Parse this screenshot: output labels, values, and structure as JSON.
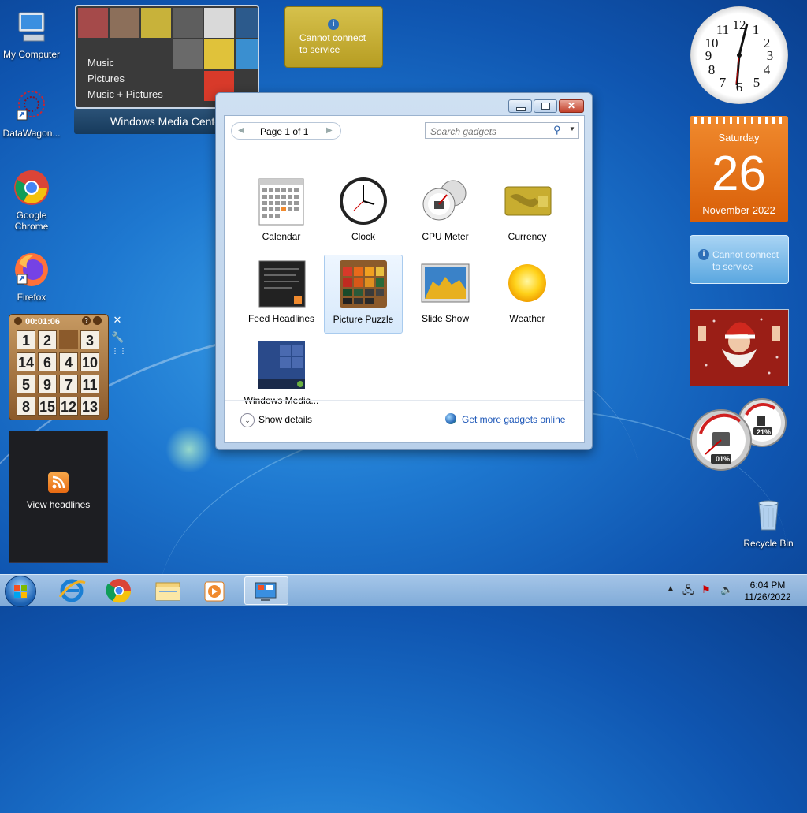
{
  "desktop_icons": [
    {
      "label": "My Computer",
      "icon": "computer-icon"
    },
    {
      "label": "DataWagon...",
      "icon": "datawagon-icon"
    },
    {
      "label": "Google Chrome",
      "icon": "chrome-icon"
    },
    {
      "label": "Firefox",
      "icon": "firefox-icon"
    },
    {
      "label": "Recycle Bin",
      "icon": "recycle-bin-icon"
    }
  ],
  "media_center": {
    "menu": [
      "Music",
      "Pictures",
      "Music + Pictures"
    ],
    "bar_label": "Windows Media Center"
  },
  "currency_top": {
    "message_line1": "Cannot connect",
    "message_line2": "to service"
  },
  "gadget_dialog": {
    "page_label": "Page 1 of 1",
    "search_placeholder": "Search gadgets",
    "items": [
      {
        "label": "Calendar",
        "selected": false
      },
      {
        "label": "Clock",
        "selected": false
      },
      {
        "label": "CPU Meter",
        "selected": false
      },
      {
        "label": "Currency",
        "selected": false
      },
      {
        "label": "Feed Headlines",
        "selected": false
      },
      {
        "label": "Picture Puzzle",
        "selected": true
      },
      {
        "label": "Slide Show",
        "selected": false
      },
      {
        "label": "Weather",
        "selected": false
      },
      {
        "label": "Windows Media...",
        "selected": false
      }
    ],
    "show_details": "Show details",
    "get_more": "Get more gadgets online"
  },
  "calendar_gadget": {
    "weekday": "Saturday",
    "day": "26",
    "month_year": "November 2022"
  },
  "currency_right": {
    "message_line1": "Cannot connect",
    "message_line2": "to service"
  },
  "puzzle": {
    "timer": "00:01:06",
    "tiles": [
      "1",
      "2",
      "",
      "3",
      "14",
      "6",
      "4",
      "10",
      "5",
      "9",
      "7",
      "11",
      "8",
      "15",
      "12",
      "13"
    ]
  },
  "feed": {
    "label": "View headlines"
  },
  "cpu_meter": {
    "cpu": "01%",
    "memory": "21%"
  },
  "taskbar": {
    "apps": [
      "start-orb",
      "internet-explorer-icon",
      "chrome-icon",
      "file-explorer-icon",
      "media-player-icon",
      "gadgets-icon"
    ],
    "time": "6:04 PM",
    "date": "11/26/2022"
  },
  "colors": {
    "desktop": "#1e78d0",
    "calendar": "#e06a12",
    "accent_link": "#1d57b8"
  }
}
